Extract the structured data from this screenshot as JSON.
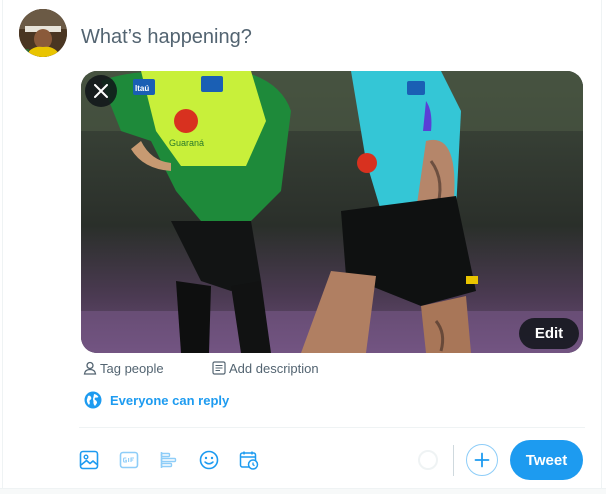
{
  "composer": {
    "placeholder": "What’s happening?"
  },
  "media": {
    "remove_icon": "close-icon",
    "edit_label": "Edit",
    "jersey_text": [
      "Itaú",
      "Guaraná"
    ]
  },
  "media_actions": {
    "tag_people": "Tag people",
    "add_description": "Add description"
  },
  "reply_setting": {
    "icon": "globe-icon",
    "label": "Everyone can reply"
  },
  "toolbar": {
    "icons": [
      "image-icon",
      "gif-icon",
      "poll-icon",
      "emoji-icon",
      "schedule-icon"
    ],
    "add_thread_icon": "plus-icon",
    "tweet_label": "Tweet"
  },
  "colors": {
    "accent": "#1d9bf0",
    "placeholder": "#536471",
    "divider": "#eff3f4"
  }
}
